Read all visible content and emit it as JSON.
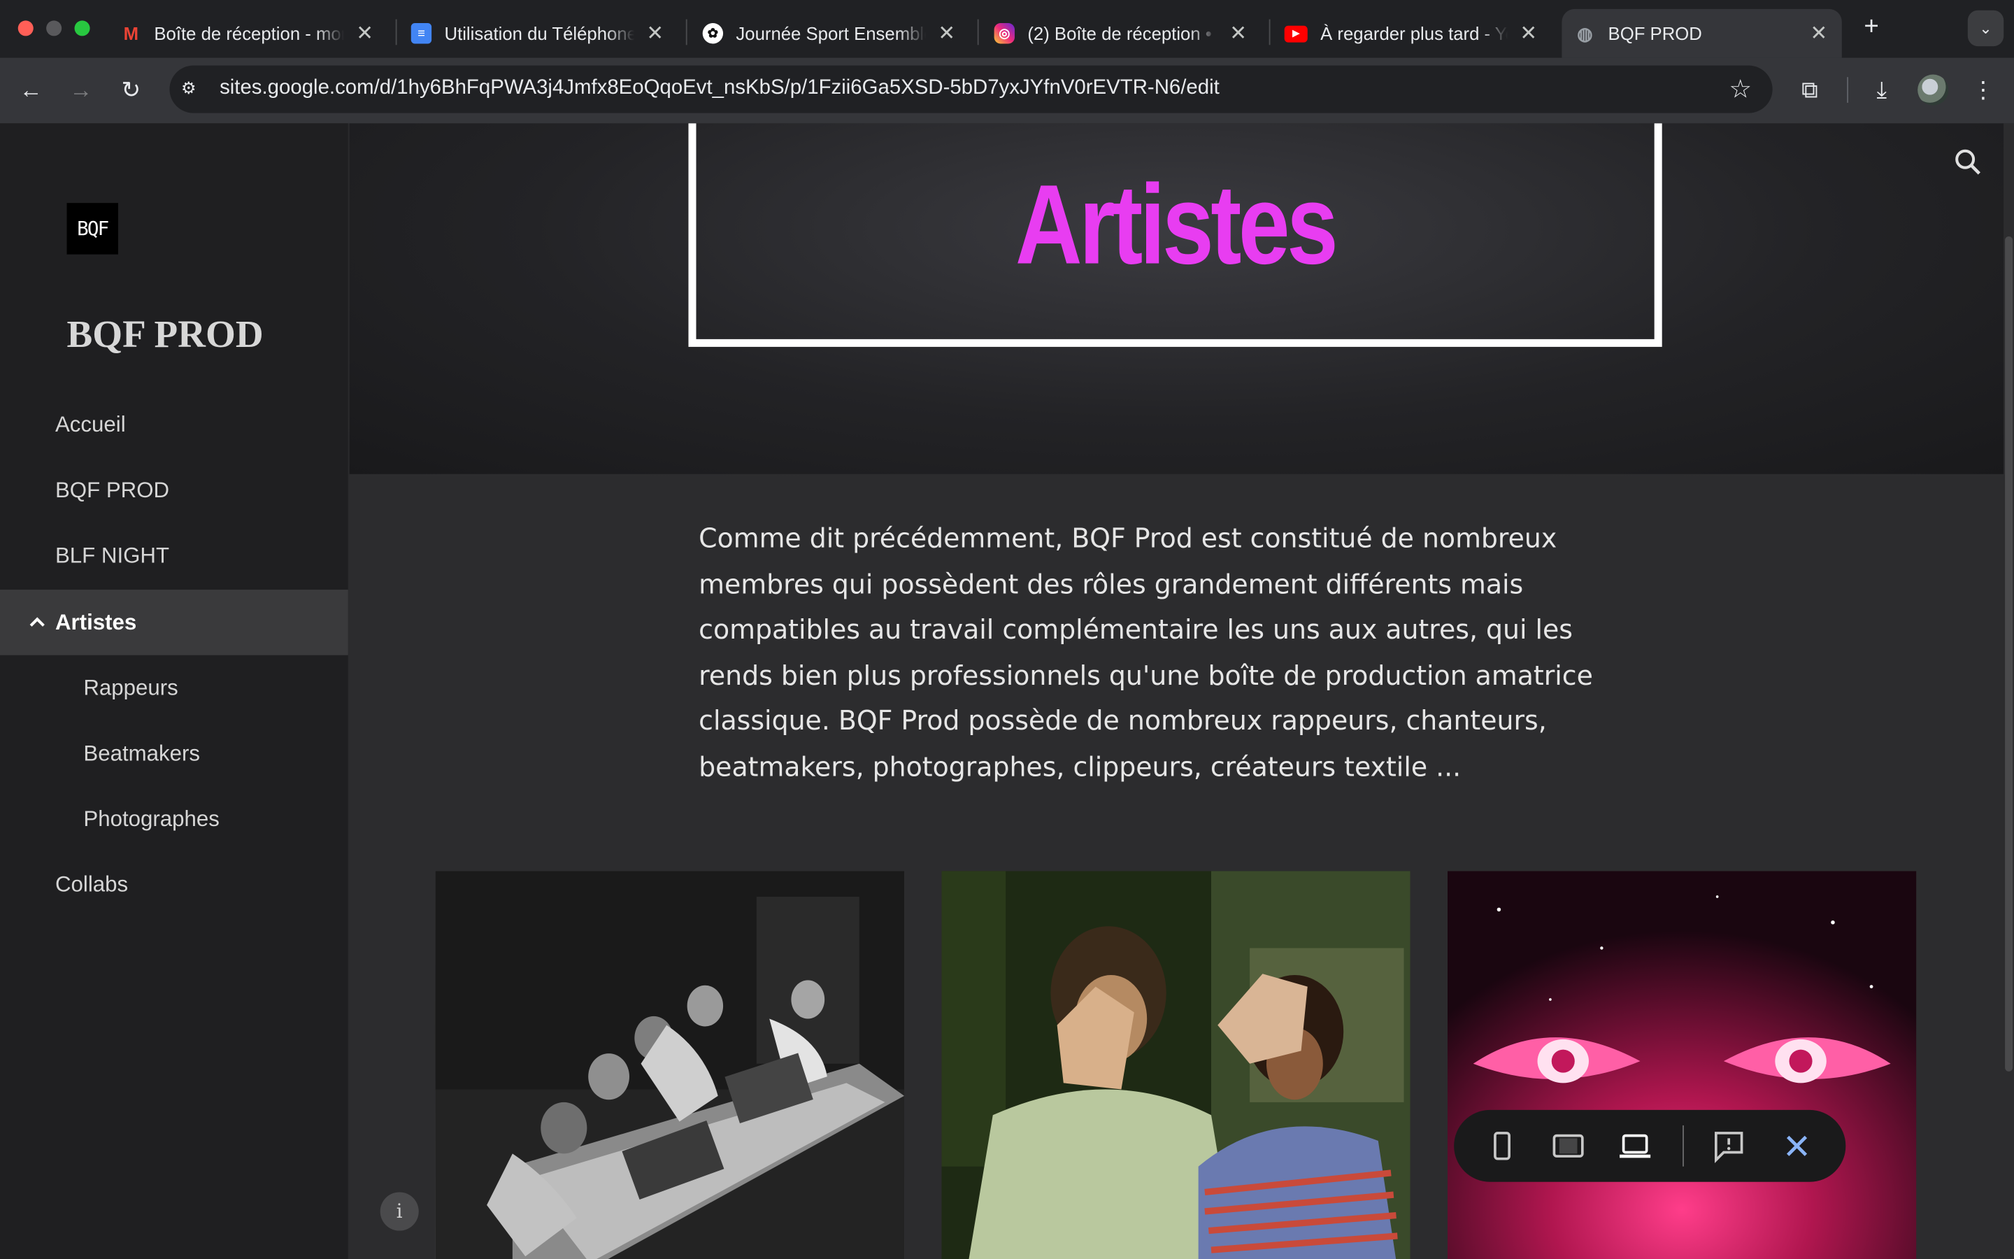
{
  "browser": {
    "tabs": [
      {
        "title": "Boîte de réception - mor",
        "icon": "gmail-icon"
      },
      {
        "title": "Utilisation du Téléphone",
        "icon": "google-docs-icon"
      },
      {
        "title": "Journée Sport Ensemble",
        "icon": "chatgpt-icon"
      },
      {
        "title": "(2) Boîte de réception •",
        "icon": "instagram-icon"
      },
      {
        "title": "À regarder plus tard - Yo",
        "icon": "youtube-icon"
      },
      {
        "title": "BQF PROD",
        "icon": "globe-icon",
        "active": true
      }
    ],
    "url": "sites.google.com/d/1hy6BhFqPWA3j4Jmfx8EoQqoEvt_nsKbS/p/1Fzii6Ga5XSD-5bD7yxJYfnV0rEVTR-N6/edit"
  },
  "site": {
    "logo_text": "BQF",
    "title": "BQF PROD",
    "nav": [
      {
        "label": "Accueil",
        "level": 1
      },
      {
        "label": "BQF PROD",
        "level": 1
      },
      {
        "label": "BLF NIGHT",
        "level": 1
      },
      {
        "label": "Artistes",
        "level": 1,
        "active": true,
        "expanded": true
      },
      {
        "label": "Rappeurs",
        "level": 2
      },
      {
        "label": "Beatmakers",
        "level": 2
      },
      {
        "label": "Photographes",
        "level": 2
      },
      {
        "label": "Collabs",
        "level": 1
      }
    ]
  },
  "page": {
    "hero_title": "Artistes",
    "hero_title_color": "#e83df1",
    "intro": "Comme dit précédemment, BQF Prod est constitué de nombreux membres qui possèdent des rôles grandement différents mais compatibles au travail complémentaire les uns aux autres, qui les rends bien plus professionnels qu'une boîte de production amatrice classique. BQF Prod possède de nombreux rappeurs, chanteurs, beatmakers, photographes, clippeurs, créateurs textile ..."
  },
  "preview_toolbar": {
    "buttons": [
      "phone-preview-icon",
      "tablet-preview-icon",
      "laptop-preview-icon",
      "feedback-icon",
      "close-icon"
    ],
    "accent": "#8ab4f8"
  }
}
